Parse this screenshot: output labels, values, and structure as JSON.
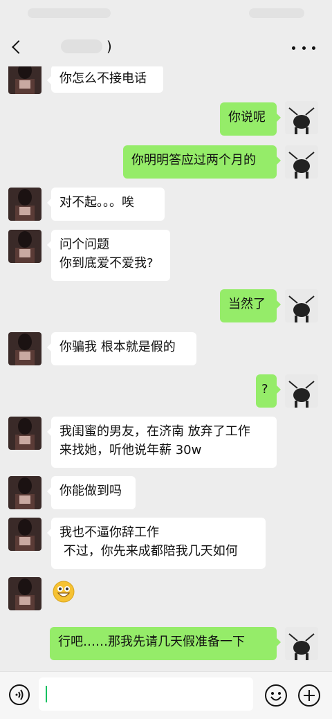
{
  "header": {
    "title": ")"
  },
  "messages": [
    {
      "side": "left",
      "text": "你怎么不接电话"
    },
    {
      "side": "right",
      "text": "你说呢"
    },
    {
      "side": "right",
      "text": "你明明答应过两个月的"
    },
    {
      "side": "left",
      "text": "对不起。。。唉"
    },
    {
      "side": "left",
      "text": "问个问题\n你到底爱不爱我?"
    },
    {
      "side": "right",
      "text": "当然了"
    },
    {
      "side": "left",
      "text": "你骗我 根本就是假的"
    },
    {
      "side": "right",
      "text": "?"
    },
    {
      "side": "left",
      "text": "我闺蜜的男友，在济南 放弃了工作\n来找她，听他说年薪 30w"
    },
    {
      "side": "left",
      "text": "你能做到吗"
    },
    {
      "side": "left",
      "text": "我也不逼你辞工作\n 不过，你先来成都陪我几天如何"
    },
    {
      "side": "left",
      "emoji": "grinning-face"
    },
    {
      "side": "right",
      "text": "行吧……那我先请几天假准备一下"
    }
  ],
  "colors": {
    "sent_bubble": "#95ec69",
    "received_bubble": "#ffffff",
    "background": "#ededed"
  }
}
